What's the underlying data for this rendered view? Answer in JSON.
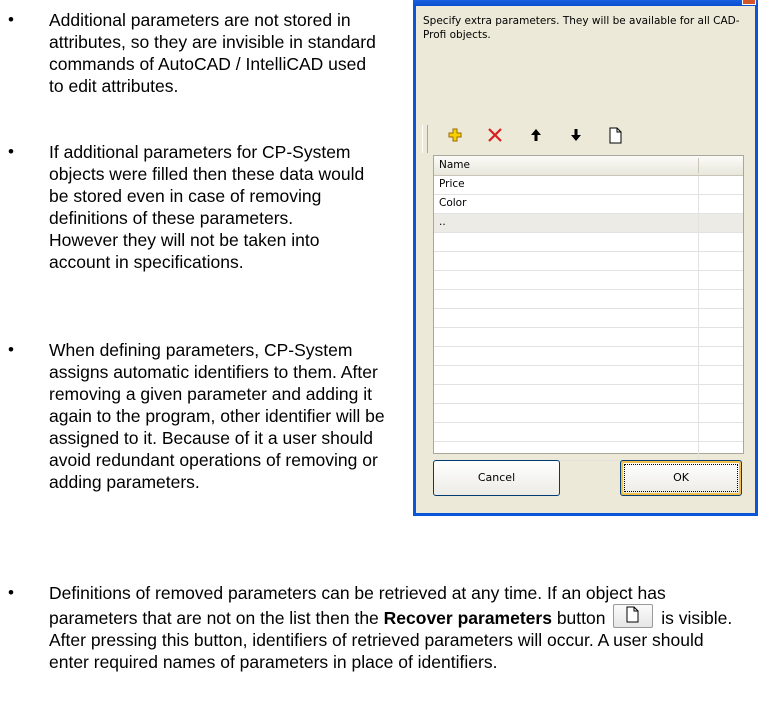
{
  "bullets": [
    "Additional parameters are not stored in attributes, so they are invisible in standard commands of AutoCAD / IntelliCAD used to edit attributes.",
    "If additional parameters for CP-System objects were filled then these data would be stored even in case of removing definitions of these parameters.",
    "However they will not be taken into account in specifications.",
    "When defining parameters, CP-System assigns automatic identifiers to them. After removing a given parameter and adding it again to the program, other identifier will be assigned to it. Because of it a user should avoid redundant operations of removing or adding parameters."
  ],
  "last_bullet": {
    "before": "Definitions of removed parameters can be retrieved at any time. If an object has parameters that are not on the list then the ",
    "bold": "Recover parameters",
    "after_bold": " button",
    "after_icon": " is visible. After pressing this button, identifiers of retrieved parameters will occur. A user should enter required names of parameters in place of identifiers."
  },
  "dialog": {
    "description": "Specify extra parameters. They will be available for all CAD-Profi objects.",
    "toolbar_icons": [
      "add-icon",
      "delete-icon",
      "move-up-icon",
      "move-down-icon",
      "recover-parameters-icon"
    ],
    "grid_header": "Name",
    "rows": [
      "Price",
      "Color",
      ".."
    ],
    "cancel_label": "Cancel",
    "ok_label": "OK"
  },
  "colors": {
    "dialog_bg": "#ece9d8",
    "title_blue": "#0a56d8",
    "add_icon": "#e8b800",
    "delete_icon": "#d81e1e"
  }
}
